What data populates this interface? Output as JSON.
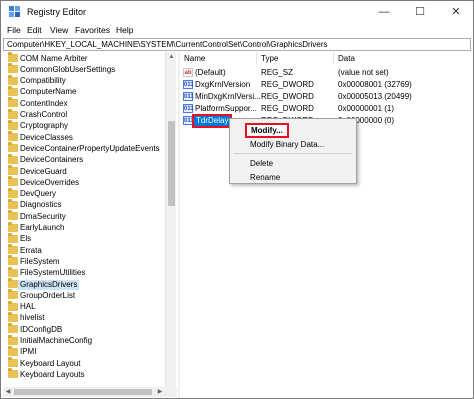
{
  "window": {
    "title": "Registry Editor",
    "controls": {
      "minimize": "—",
      "maximize": "☐",
      "close": "✕"
    }
  },
  "menubar": [
    "File",
    "Edit",
    "View",
    "Favorites",
    "Help"
  ],
  "address": "Computer\\HKEY_LOCAL_MACHINE\\SYSTEM\\CurrentControlSet\\Control\\GraphicsDrivers",
  "tree": {
    "items": [
      "COM Name Arbiter",
      "CommonGlobUserSettings",
      "Compatibility",
      "ComputerName",
      "ContentIndex",
      "CrashControl",
      "Cryptography",
      "DeviceClasses",
      "DeviceContainerPropertyUpdateEvents",
      "DeviceContainers",
      "DeviceGuard",
      "DeviceOverrides",
      "DevQuery",
      "Diagnostics",
      "DmaSecurity",
      "EarlyLaunch",
      "Els",
      "Errata",
      "FileSystem",
      "FileSystemUtilities",
      "GraphicsDrivers",
      "GroupOrderList",
      "HAL",
      "hivelist",
      "IDConfigDB",
      "InitialMachineConfig",
      "IPMI",
      "Keyboard Layout",
      "Keyboard Layouts"
    ],
    "selected": "GraphicsDrivers"
  },
  "values": {
    "headers": {
      "name": "Name",
      "type": "Type",
      "data": "Data"
    },
    "rows": [
      {
        "icon": "string-value-icon",
        "glyph": "ab",
        "name": "(Default)",
        "type": "REG_SZ",
        "data": "(value not set)"
      },
      {
        "icon": "dword-value-icon",
        "glyph": "011",
        "name": "DxgKrnlVersion",
        "type": "REG_DWORD",
        "data": "0x00008001 (32769)"
      },
      {
        "icon": "dword-value-icon",
        "glyph": "011",
        "name": "MinDxgKrnlVersi...",
        "type": "REG_DWORD",
        "data": "0x00005013 (20499)"
      },
      {
        "icon": "dword-value-icon",
        "glyph": "011",
        "name": "PlatformSuppor...",
        "type": "REG_DWORD",
        "data": "0x00000001 (1)"
      },
      {
        "icon": "dword-value-icon",
        "glyph": "011",
        "name": "TdrDelay",
        "type": "REG_DWORD",
        "data": "0x00000000 (0)"
      }
    ]
  },
  "context_menu": {
    "modify": "Modify...",
    "modify_binary": "Modify Binary Data...",
    "delete": "Delete",
    "rename": "Rename"
  },
  "colors": {
    "selection": "#0078d7",
    "highlight_border": "#e81123",
    "folder": "#e8c254"
  }
}
